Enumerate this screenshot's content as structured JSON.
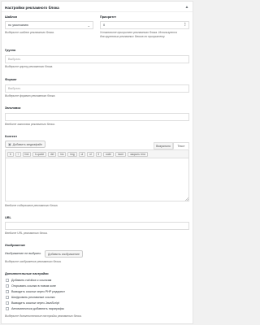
{
  "panel": {
    "title": "Настройки рекламного блока",
    "toggle_icon": "triangle-up-icon"
  },
  "template": {
    "label": "Шаблон",
    "value": "по умолчанию",
    "description": "Выберите шаблон рекламного блока."
  },
  "priority": {
    "label": "Приоритет",
    "value": "0",
    "description_line1": "Установите приоритет рекламного блока. Используется",
    "description_line2": "для групповых рекламных блоков по приоритету."
  },
  "group": {
    "label": "Группа",
    "placeholder": "Выбрать",
    "description": "Выберите группу рекламного блока."
  },
  "format": {
    "label": "Формат",
    "placeholder": "Выбрать",
    "description": "Выберите формат рекламного блока."
  },
  "heading_field": {
    "label": "Заголовок",
    "value": "",
    "description": "Введите заголовок рекламного блока."
  },
  "content": {
    "label": "Контент",
    "add_media_label": "Добавить медиафайл",
    "add_media_icon": "media-icon",
    "tab_visual": "Визуально",
    "tab_text": "Текст",
    "quicktags": [
      "b",
      "i",
      "link",
      "b-quote",
      "del",
      "ins",
      "img",
      "ul",
      "ol",
      "li",
      "code",
      "more",
      "закрыть теги"
    ],
    "description": "Введите содержимое рекламного блока."
  },
  "url": {
    "label": "URL",
    "value": "",
    "description": "Введите URL рекламного блока."
  },
  "image": {
    "label": "Изображение",
    "status": "Изображение не выбрано",
    "button": "Добавить изображение",
    "description": "Выберите изображение рекламного блока."
  },
  "extra": {
    "label": "Дополнительные настройки",
    "options": [
      "Добавить nofollow к ссылкам",
      "Открывать ссылки в новом окне",
      "Выводить ссылки через PHP редирект",
      "Шифровать рекламные ссылки",
      "Выводить ссылки через JavaScript",
      "Автоматически добавлять параграфы"
    ],
    "description": "Выберите дополнительные настройки рекламного блока."
  }
}
